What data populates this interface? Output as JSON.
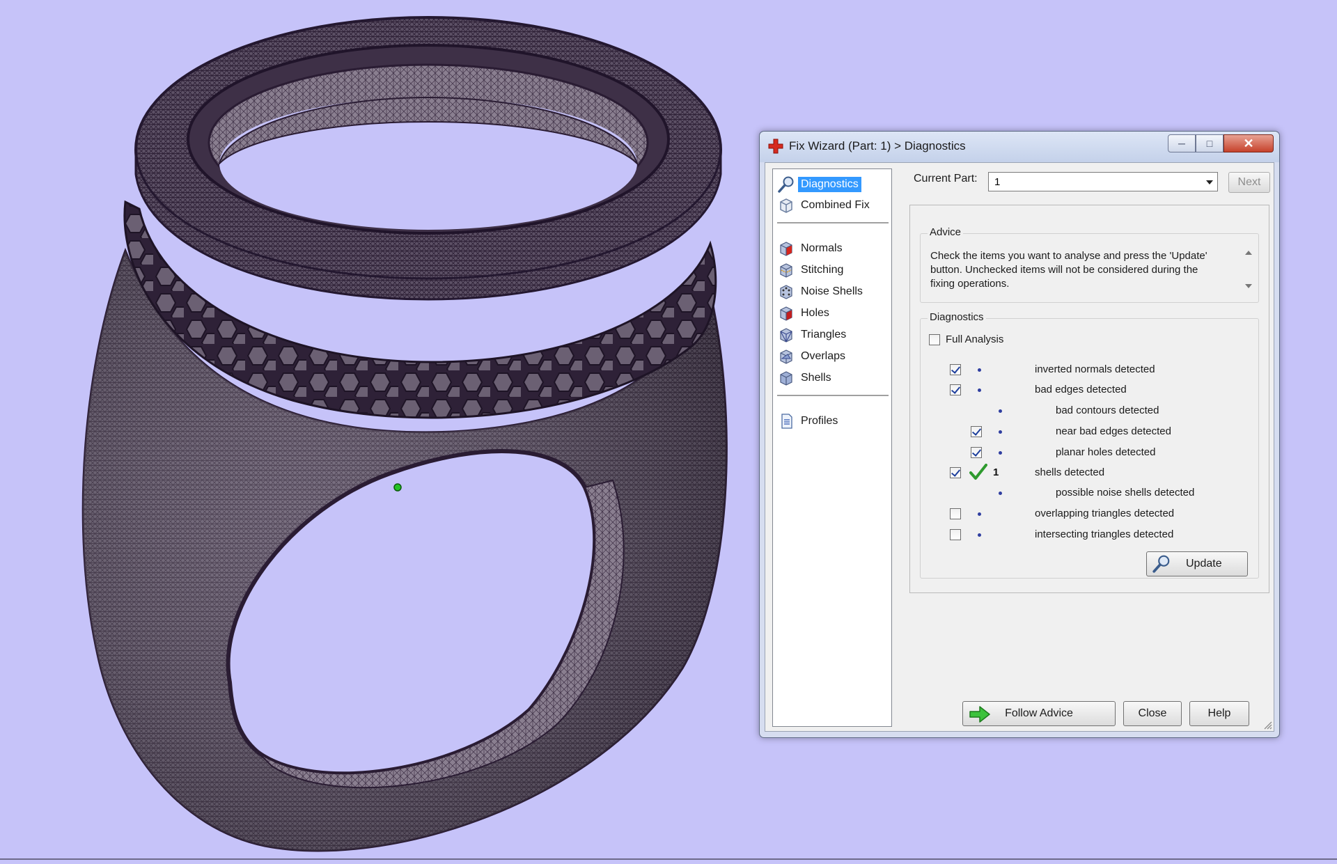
{
  "dialog": {
    "title": "Fix Wizard (Part: 1) > Diagnostics",
    "window_buttons": [
      "minimize",
      "maximize",
      "close"
    ]
  },
  "nav": {
    "items": [
      {
        "label": "Diagnostics",
        "icon": "magnifier-icon",
        "selected": true
      },
      {
        "label": "Combined Fix",
        "icon": "cube-outline-icon"
      },
      {
        "label": "Normals",
        "icon": "normals-cube-icon"
      },
      {
        "label": "Stitching",
        "icon": "stitching-cube-icon"
      },
      {
        "label": "Noise Shells",
        "icon": "noise-shells-cube-icon"
      },
      {
        "label": "Holes",
        "icon": "holes-cube-icon"
      },
      {
        "label": "Triangles",
        "icon": "triangles-cube-icon"
      },
      {
        "label": "Overlaps",
        "icon": "overlaps-cube-icon"
      },
      {
        "label": "Shells",
        "icon": "shells-cube-icon"
      },
      {
        "label": "Profiles",
        "icon": "document-icon"
      }
    ]
  },
  "current_part": {
    "label": "Current Part:",
    "value": "1",
    "next_label": "Next"
  },
  "advice": {
    "title": "Advice",
    "text": "Check the items you want to analyse and press the 'Update' button. Unchecked items will not be considered during the fixing operations."
  },
  "diagnostics": {
    "title": "Diagnostics",
    "full_analysis_label": "Full Analysis",
    "full_analysis_checked": false,
    "items": [
      {
        "label": "inverted normals detected",
        "checked": true,
        "indent": 0,
        "has_checkbox": true,
        "count": ""
      },
      {
        "label": "bad edges detected",
        "checked": true,
        "indent": 0,
        "has_checkbox": true,
        "count": ""
      },
      {
        "label": "bad contours detected",
        "checked": false,
        "indent": 1,
        "has_checkbox": false,
        "count": ""
      },
      {
        "label": "near bad edges detected",
        "checked": true,
        "indent": 1,
        "has_checkbox": true,
        "count": ""
      },
      {
        "label": "planar holes detected",
        "checked": true,
        "indent": 1,
        "has_checkbox": true,
        "count": ""
      },
      {
        "label": "shells detected",
        "checked": true,
        "indent": 0,
        "has_checkbox": true,
        "count": "1",
        "status": "ok"
      },
      {
        "label": "possible noise shells detected",
        "checked": false,
        "indent": 1,
        "has_checkbox": false,
        "count": ""
      },
      {
        "label": "overlapping triangles detected",
        "checked": false,
        "indent": 0,
        "has_checkbox": true,
        "count": ""
      },
      {
        "label": "intersecting triangles detected",
        "checked": false,
        "indent": 0,
        "has_checkbox": true,
        "count": ""
      }
    ],
    "update_label": "Update"
  },
  "footer": {
    "follow_advice_label": "Follow Advice",
    "close_label": "Close",
    "help_label": "Help"
  },
  "colors": {
    "viewport_background": "#c6c3f9",
    "mesh": "#3b2c45",
    "selection": "#3399ff"
  }
}
